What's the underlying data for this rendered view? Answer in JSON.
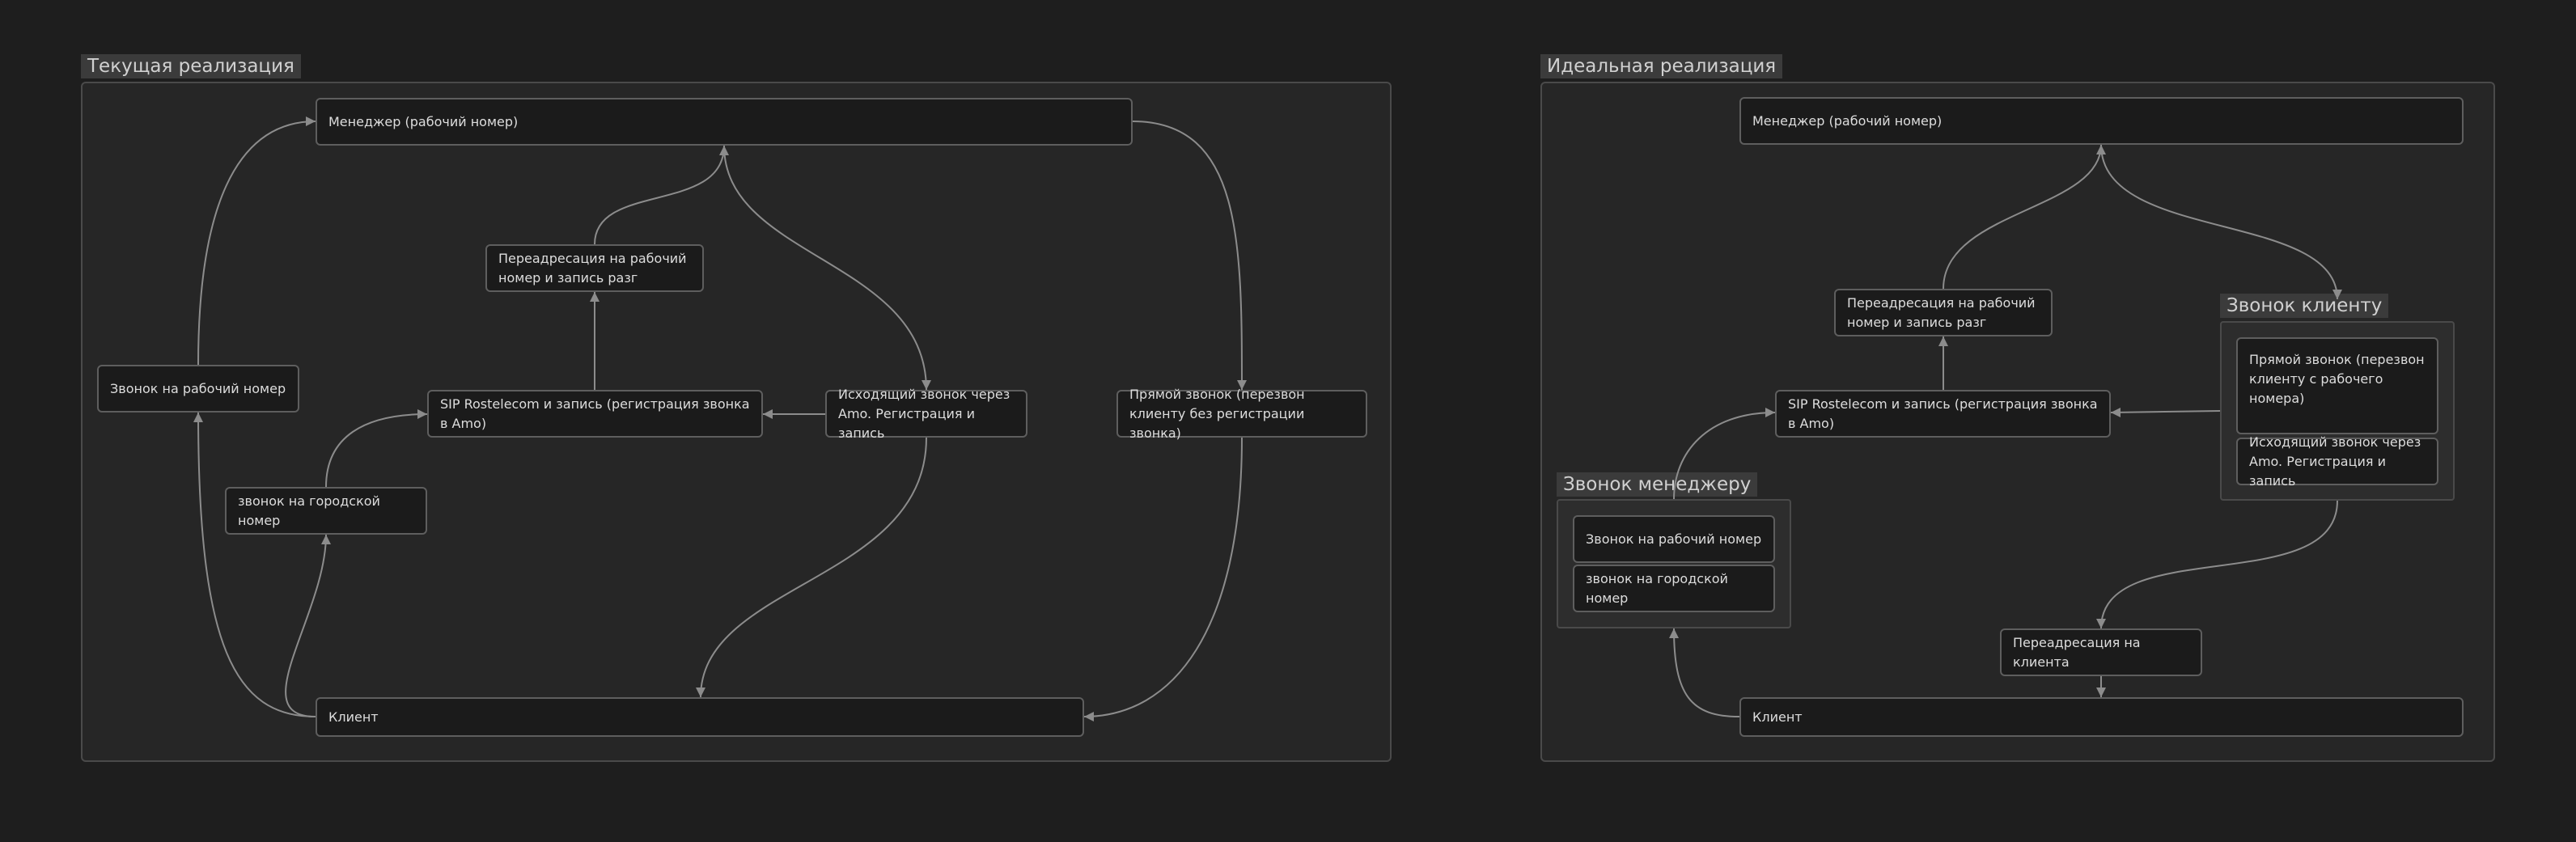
{
  "colors": {
    "background": "#1e1e1e",
    "group": "#262626",
    "node": "#1b1b1b",
    "edge": "#8c8c8c",
    "text": "#dddddd"
  },
  "left": {
    "title": "Текущая реализация",
    "nodes": {
      "manager": "Менеджер (рабочий номер)",
      "redirect": "Переадресация на рабочий номер и запись разг",
      "work_call": "Звонок на рабочий номер",
      "sip": "SIP Rostelecom и запись (регистрация звонка в Amo)",
      "outgoing": "Исходящий звонок через Amo. Регистрация и запись",
      "direct": "Прямой звонок (перезвон клиенту без регистрации звонка)",
      "city_call": "звонок на городской номер",
      "client": "Клиент"
    }
  },
  "right": {
    "title": "Идеальная реализация",
    "nodes": {
      "manager": "Менеджер (рабочий номер)",
      "redirect": "Переадресация на рабочий номер и запись разг",
      "sip": "SIP Rostelecom и запись (регистрация звонка в Amo)",
      "redirect_client": "Переадресация на клиента",
      "client": "Клиент"
    },
    "call_client": {
      "title": "Звонок клиенту",
      "direct": "Прямой звонок (перезвон клиенту с рабочего номера)",
      "outgoing": "Исходящий звонок через Amo. Регистрация и запись"
    },
    "call_manager": {
      "title": "Звонок менеджеру",
      "work_call": "Звонок на рабочий номер",
      "city_call": "звонок на городской номер"
    }
  }
}
